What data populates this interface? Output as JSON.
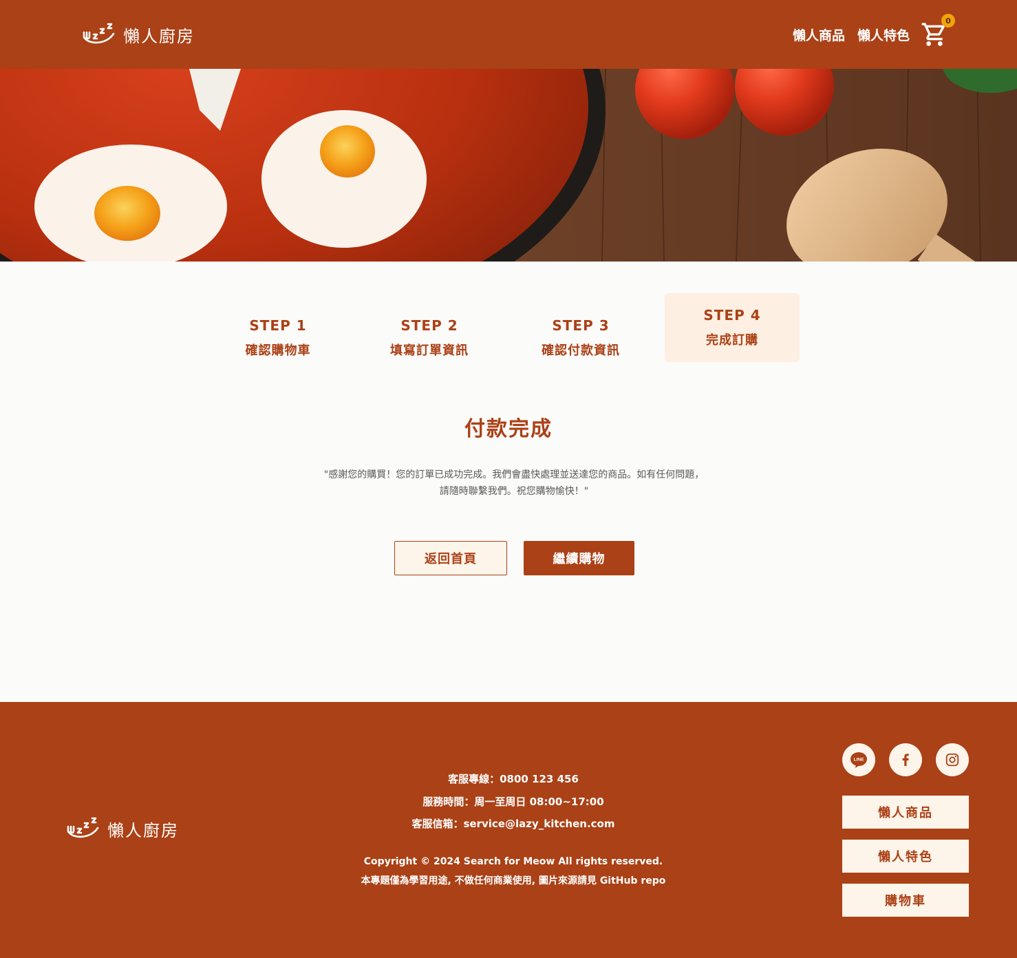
{
  "brand": {
    "name": "懶人廚房",
    "logo_icon": "sleeping-face-fork-icon"
  },
  "header": {
    "nav": [
      {
        "label": "懶人商品"
      },
      {
        "label": "懶人特色"
      }
    ],
    "cart": {
      "icon": "shopping-cart-icon",
      "count": "0"
    }
  },
  "hero": {
    "image": "shakshuka-eggs-tomato-spoon-photo"
  },
  "steps": [
    {
      "num": "STEP 1",
      "label": "確認購物車",
      "active": false
    },
    {
      "num": "STEP 2",
      "label": "填寫訂單資訊",
      "active": false
    },
    {
      "num": "STEP 3",
      "label": "確認付款資訊",
      "active": false
    },
    {
      "num": "STEP 4",
      "label": "完成訂購",
      "active": true
    }
  ],
  "result": {
    "title": "付款完成",
    "message_line1": "\"感謝您的購買！您的訂單已成功完成。我們會盡快處理並送達您的商品。如有任何問題，",
    "message_line2": "請隨時聯繫我們。祝您購物愉快！\""
  },
  "actions": {
    "home_label": "返回首頁",
    "continue_label": "繼續購物"
  },
  "footer": {
    "phone": "客服專線：0800 123 456",
    "hours": "服務時間：周一至周日 08:00~17:00",
    "email": "客服信箱：service@lazy_kitchen.com",
    "copyright": "Copyright © 2024 Search for Meow All rights reserved.",
    "disclaimer": "本專題僅為學習用途, 不做任何商業使用, 圖片來源請見 GitHub repo",
    "socials": [
      {
        "icon": "line-icon",
        "text": "LINE"
      },
      {
        "icon": "facebook-icon"
      },
      {
        "icon": "instagram-icon"
      }
    ],
    "links": [
      {
        "label": "懶人商品"
      },
      {
        "label": "懶人特色"
      },
      {
        "label": "購物車"
      }
    ]
  },
  "colors": {
    "brand": "#ab4116",
    "cream": "#fdf4ea",
    "step_active_bg": "#fdefe2",
    "badge": "#f0a40a",
    "text_gray": "#5a5a5a"
  }
}
